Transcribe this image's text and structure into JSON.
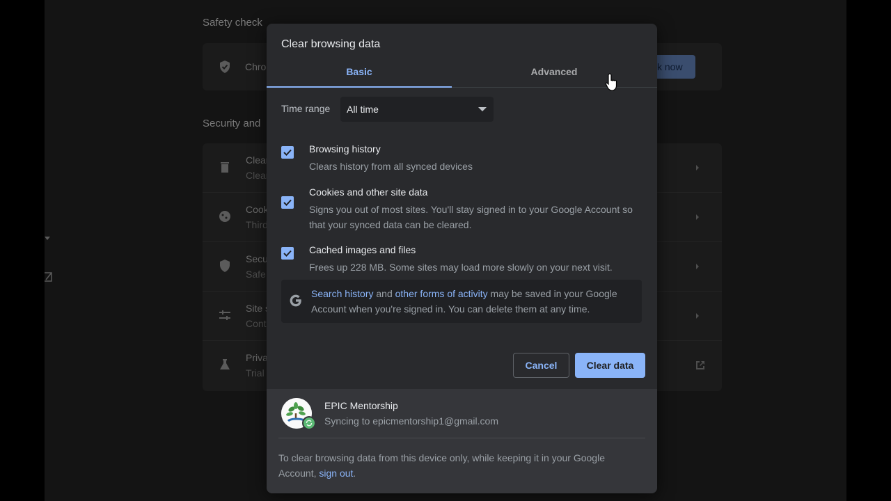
{
  "background": {
    "safety_heading": "Safety check",
    "safety_row_text": "Chro",
    "check_now_label": "ck now",
    "security_heading": "Security and",
    "rows": [
      {
        "title": "Clear",
        "subtitle": "Clear"
      },
      {
        "title": "Cook",
        "subtitle": "Third"
      },
      {
        "title": "Secu",
        "subtitle": "Safe"
      },
      {
        "title": "Site s",
        "subtitle": "Cont"
      },
      {
        "title": "Priva",
        "subtitle": "Trial"
      }
    ]
  },
  "dialog": {
    "title": "Clear browsing data",
    "tabs": [
      {
        "label": "Basic",
        "selected": true
      },
      {
        "label": "Advanced",
        "selected": false
      }
    ],
    "time_range": {
      "label": "Time range",
      "value": "All time"
    },
    "options": [
      {
        "title": "Browsing history",
        "description": "Clears history from all synced devices",
        "checked": true
      },
      {
        "title": "Cookies and other site data",
        "description": "Signs you out of most sites. You'll stay signed in to your Google Account so that your synced data can be cleared.",
        "checked": true
      },
      {
        "title": "Cached images and files",
        "description": "Frees up 228 MB. Some sites may load more slowly on your next visit.",
        "checked": true
      }
    ],
    "notice": {
      "link1": "Search history",
      "mid": " and ",
      "link2": "other forms of activity",
      "rest": " may be saved in your Google Account when you're signed in. You can delete them at any time."
    },
    "cancel_label": "Cancel",
    "clear_label": "Clear data",
    "account": {
      "name": "EPIC Mentorship",
      "sync_text": "Syncing to epicmentorship1@gmail.com"
    },
    "footer_note": {
      "text": "To clear browsing data from this device only, while keeping it in your Google Account, ",
      "link": "sign out",
      "end": "."
    }
  },
  "colors": {
    "accent": "#8ab4f8",
    "dialog_bg": "#292a2d",
    "footer_bg": "#35363a"
  }
}
